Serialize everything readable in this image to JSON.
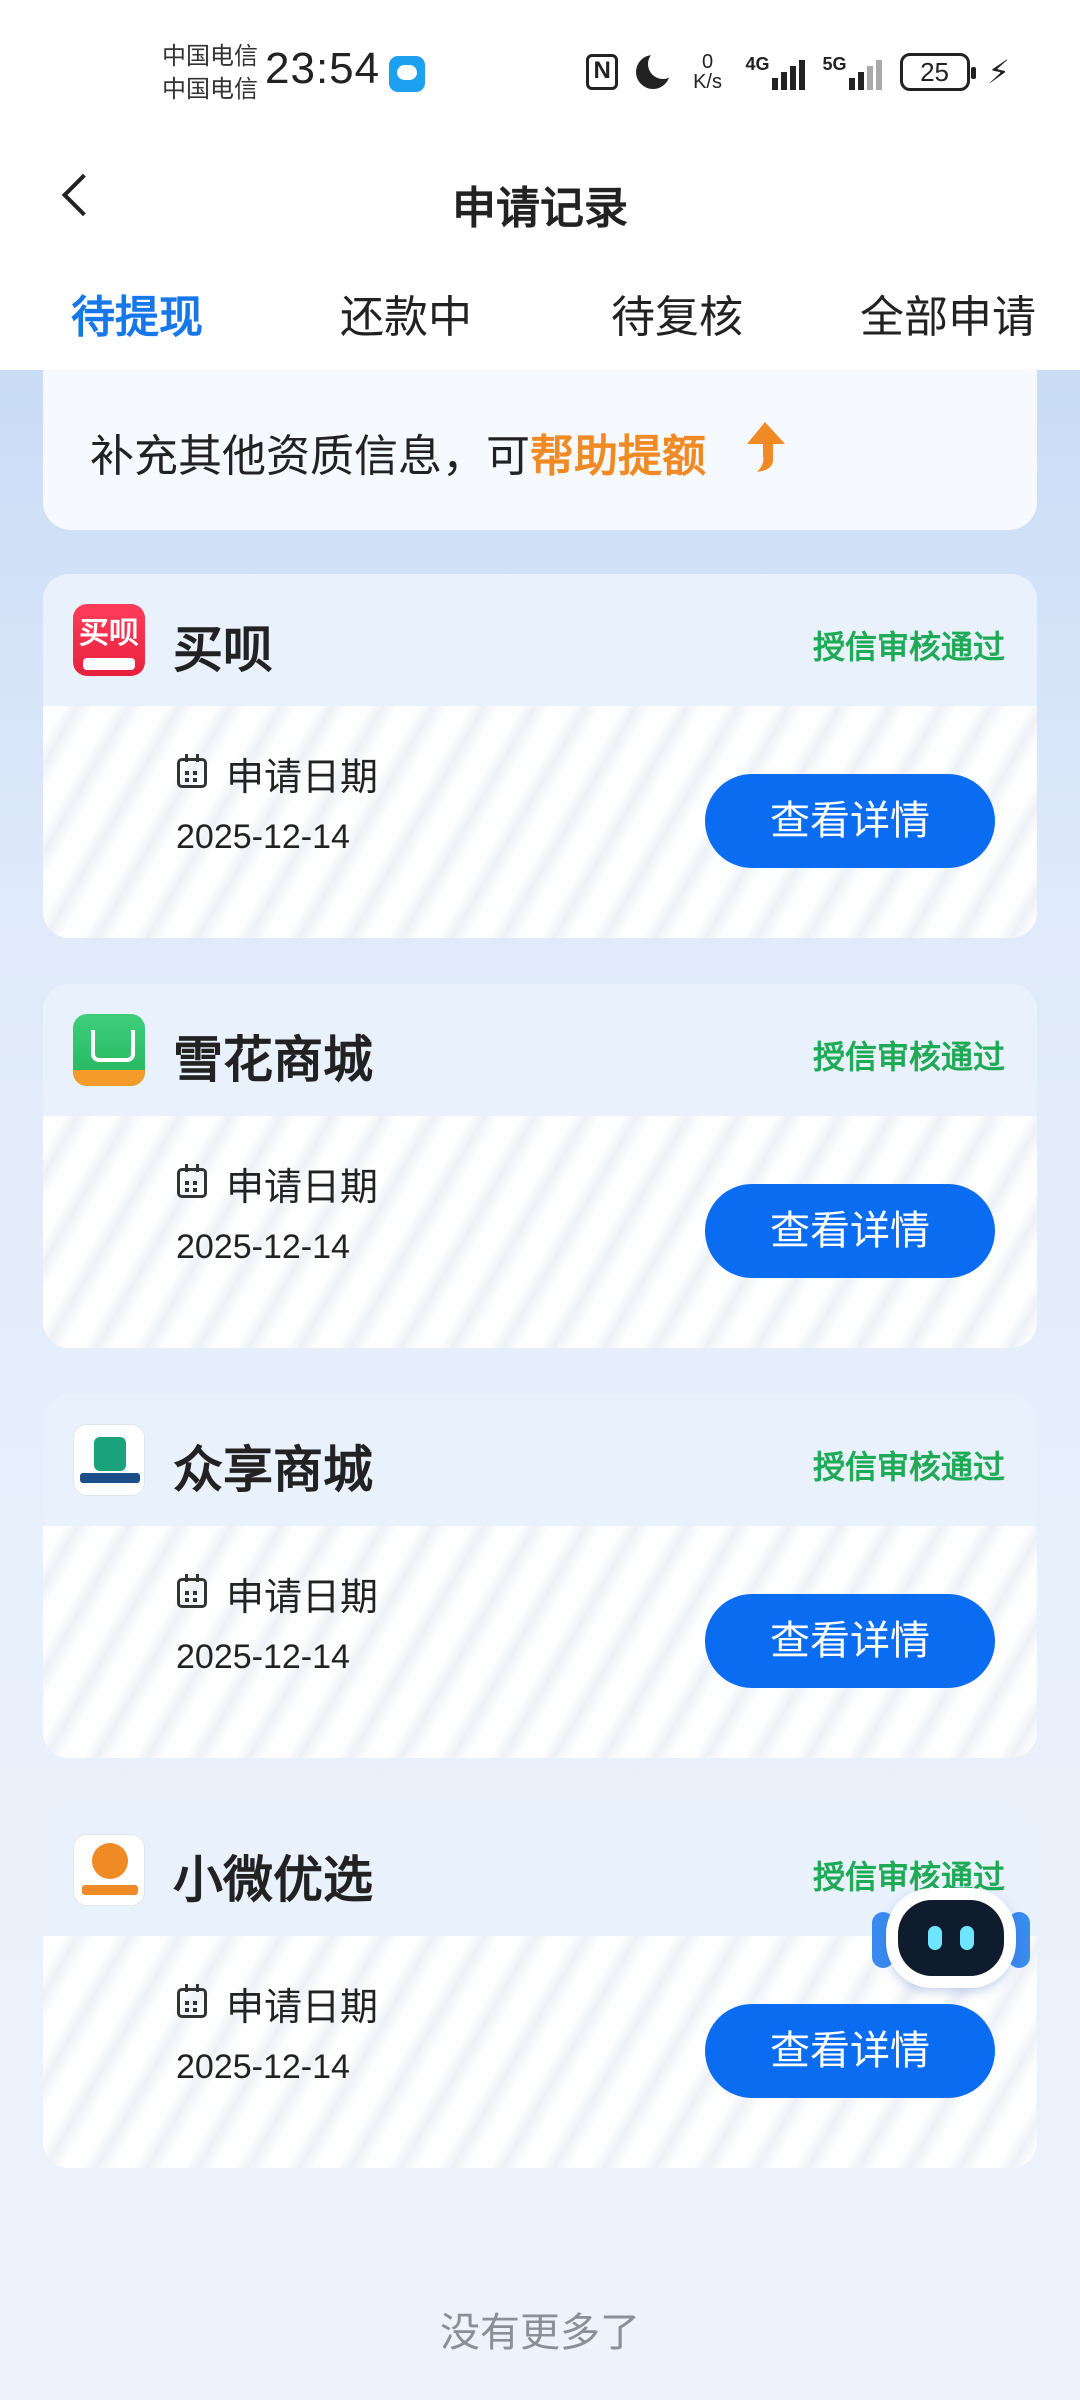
{
  "status_bar": {
    "carrier_1": "中国电信",
    "carrier_2": "中国电信",
    "time": "23:54",
    "net_speed_value": "0",
    "net_speed_unit": "K/s",
    "signal_1": "4G",
    "signal_2": "5G",
    "battery": "25"
  },
  "header": {
    "title": "申请记录"
  },
  "tabs": [
    {
      "label": "待提现",
      "active": true
    },
    {
      "label": "还款中",
      "active": false
    },
    {
      "label": "待复核",
      "active": false
    },
    {
      "label": "全部申请",
      "active": false
    }
  ],
  "banner": {
    "text": "补充其他资质信息，可",
    "highlight": "帮助提额"
  },
  "cards": [
    {
      "logo_text": "买呗",
      "name": "买呗",
      "status": "授信审核通过",
      "date_label": "申请日期",
      "date": "2025-12-14",
      "button": "查看详情"
    },
    {
      "name": "雪花商城",
      "status": "授信审核通过",
      "date_label": "申请日期",
      "date": "2025-12-14",
      "button": "查看详情"
    },
    {
      "name": "众享商城",
      "status": "授信审核通过",
      "date_label": "申请日期",
      "date": "2025-12-14",
      "button": "查看详情"
    },
    {
      "name": "小微优选",
      "status": "授信审核通过",
      "date_label": "申请日期",
      "date": "2025-12-14",
      "button": "查看详情"
    }
  ],
  "footer": {
    "text": "没有更多了"
  },
  "colors": {
    "accent": "#1677e8",
    "button": "#0a6cf0",
    "status_green": "#1faa55",
    "highlight_orange": "#f08a24"
  }
}
